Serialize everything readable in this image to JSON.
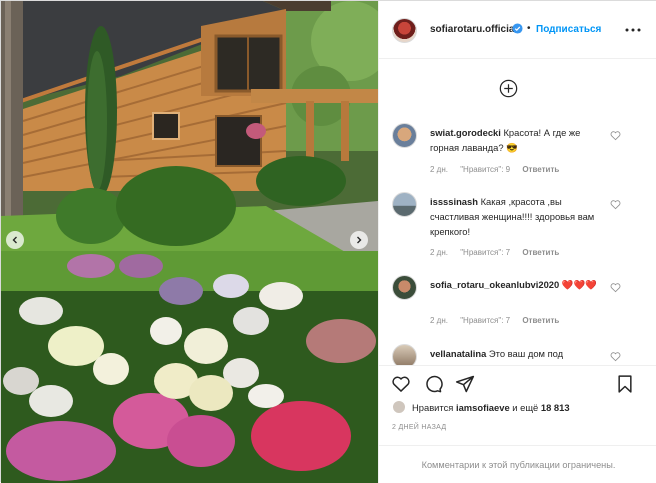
{
  "header": {
    "username": "sofiarotaru.official",
    "verified_icon": "verified-badge-icon",
    "separator": "•",
    "follow_label": "Подписаться",
    "more_icon": "more-options-icon"
  },
  "comments": [
    {
      "username": "swiat.gorodecki",
      "text": "Красота! А где же горная лаванда? 😎",
      "age": "2 дн.",
      "likes": "\"Нравится\": 9",
      "reply": "Ответить"
    },
    {
      "username": "issssinash",
      "text": "Какая ,красота ,вы счастливая женщина!!!! здоровья вам крепкого!",
      "age": "2 дн.",
      "likes": "\"Нравится\": 7",
      "reply": "Ответить"
    },
    {
      "username": "sofia_rotaru_okeanlubvi2020",
      "text": "❤️❤️❤️",
      "age": "2 дн.",
      "likes": "\"Нравится\": 7",
      "reply": "Ответить"
    },
    {
      "username": "vellanatalina",
      "text": "Это ваш дом под"
    }
  ],
  "likes": {
    "prefix": "Нравится",
    "user": "iamsofiaeve",
    "middle": "и ещё",
    "count": "18 813"
  },
  "post_age": "2 ДНЕЙ НАЗАД",
  "comments_limited": "Комментарии к этой публикации ограничены.",
  "colors": {
    "accent": "#0095f6",
    "meta": "#8e8e8e",
    "heart": "#ed4956"
  }
}
